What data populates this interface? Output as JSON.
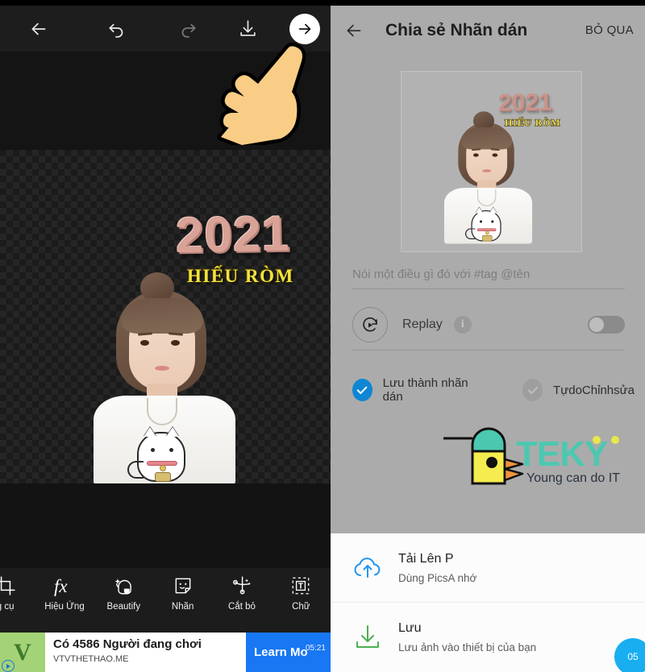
{
  "left_panel": {
    "toolbar": {
      "back_icon": "arrow-left-icon",
      "undo_icon": "undo-icon",
      "redo_icon": "redo-icon",
      "download_icon": "download-icon",
      "next_icon": "arrow-right-icon"
    },
    "canvas": {
      "overlay_year": "2021",
      "overlay_name": "HIẾU RÒM",
      "transparency_checker": true
    },
    "pointer_hint": "pointing-hand-cursor",
    "bottom_tools": [
      {
        "label": "g cụ",
        "icon": "crop-tool-icon",
        "clipped": true
      },
      {
        "label": "Hiệu Ứng",
        "icon": "fx-icon",
        "clipped": false
      },
      {
        "label": "Beautify",
        "icon": "beautify-face-icon",
        "clipped": false
      },
      {
        "label": "Nhãn",
        "icon": "sticker-icon",
        "clipped": false
      },
      {
        "label": "Cắt bỏ",
        "icon": "cutout-icon",
        "clipped": false
      },
      {
        "label": "Chữ",
        "icon": "text-tool-icon",
        "clipped": false
      }
    ],
    "ad": {
      "logo_letter": "V",
      "title": "Có 4586 Người đang chơi",
      "subtitle": "VTVTHETHAO.ME",
      "cta": "Learn Mo",
      "timer": "05:21"
    }
  },
  "right_panel": {
    "header": {
      "back_icon": "arrow-left-icon",
      "title": "Chia sẻ Nhãn dán",
      "skip": "BỎ QUA"
    },
    "preview": {
      "overlay_year": "2021",
      "overlay_name": "HIẾU RÒM"
    },
    "caption": {
      "value": "",
      "placeholder": "Nói một điều gì đó với #tag @tên"
    },
    "replay": {
      "label": "Replay",
      "icon": "replay-icon",
      "info_icon": "info-icon",
      "info_glyph": "i",
      "enabled": false
    },
    "checkboxes": [
      {
        "label": "Lưu thành nhãn dán",
        "checked": true
      },
      {
        "label": "TựdoChỉnhsửa",
        "checked": false
      }
    ],
    "watermark": {
      "brand": "TEKY",
      "tagline": "Young can do IT"
    },
    "sheet_items": [
      {
        "title": "Tải Lên P",
        "subtitle": "Dùng PicsA          nhớ",
        "icon": "cloud-upload-icon"
      },
      {
        "title": "Lưu",
        "subtitle": "Lưu ảnh vào thiết bị của bạn",
        "icon": "download-icon"
      }
    ],
    "pointer_hint": "pointing-hand-cursor",
    "corner_timer": "05"
  },
  "colors": {
    "accent_blue": "#0e86d4",
    "panel_gray": "#ababab",
    "dark_bg": "#121212",
    "sheet_white": "#fcfcfc",
    "ad_cta_blue": "#1877f2",
    "teky_teal": "#4cc8b0",
    "teky_yellow": "#f5ec4f"
  }
}
